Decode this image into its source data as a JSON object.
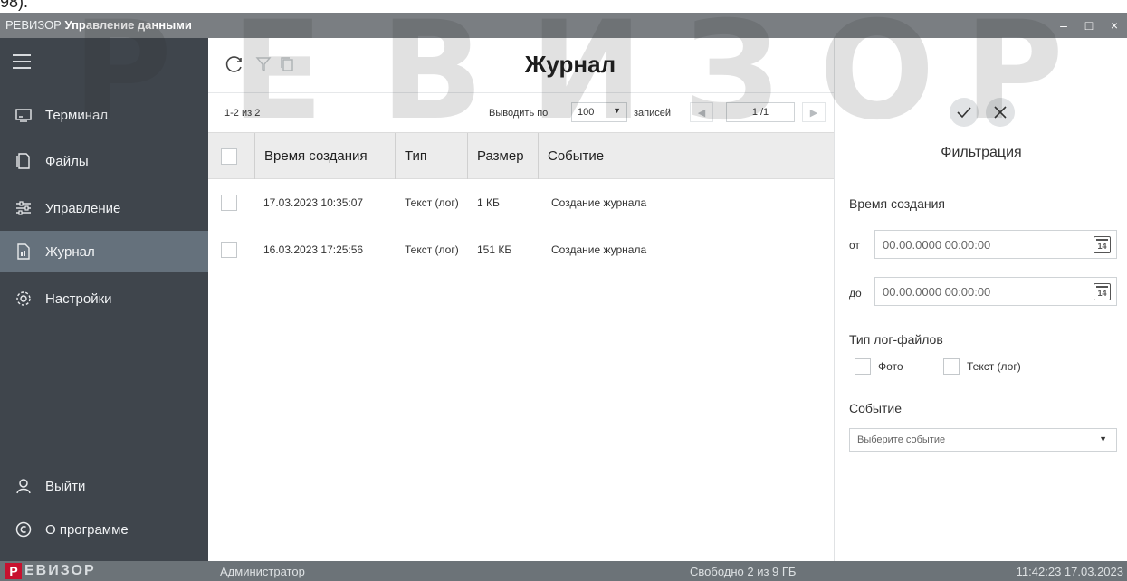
{
  "top_strip": "98).",
  "titlebar": {
    "brand": "РЕВИЗОР",
    "title": "Управление данными",
    "minimize": "–",
    "maximize": "□",
    "close": "×"
  },
  "sidebar": {
    "items": [
      {
        "label": "Терминал",
        "icon": "terminal-icon"
      },
      {
        "label": "Файлы",
        "icon": "files-icon"
      },
      {
        "label": "Управление",
        "icon": "sliders-icon"
      },
      {
        "label": "Журнал",
        "icon": "journal-icon",
        "active": true
      },
      {
        "label": "Настройки",
        "icon": "gear-icon"
      }
    ],
    "bottom": [
      {
        "label": "Выйти",
        "icon": "user-logout-icon"
      },
      {
        "label": "О программе",
        "icon": "copyright-icon"
      }
    ]
  },
  "main": {
    "title": "Журнал",
    "pager": {
      "count": "1-2 из 2",
      "per_page_label": "Выводить по",
      "per_page_value": "100",
      "records_label": "записей",
      "page": "1 /1"
    },
    "columns": [
      "Время создания",
      "Тип",
      "Размер",
      "Событие"
    ],
    "rows": [
      {
        "time": "17.03.2023 10:35:07",
        "type": "Текст (лог)",
        "size": "1 КБ",
        "event": "Создание журнала"
      },
      {
        "time": "16.03.2023 17:25:56",
        "type": "Текст (лог)",
        "size": "151 КБ",
        "event": "Создание журнала"
      }
    ]
  },
  "filter": {
    "title": "Фильтрация",
    "created_label": "Время создания",
    "from_label": "от",
    "from_value": "00.00.0000 00:00:00",
    "to_label": "до",
    "to_value": "00.00.0000 00:00:00",
    "calendar_day": "14",
    "type_label": "Тип лог-файлов",
    "type_photo": "Фото",
    "type_text": "Текст (лог)",
    "event_label": "Событие",
    "event_placeholder": "Выберите событие"
  },
  "statusbar": {
    "logo_letter": "Р",
    "logo_rest": "ЕВИЗОР",
    "user": "Администратор",
    "free": "Свободно 2 из 9 ГБ",
    "time": "11:42:23 17.03.2023"
  },
  "watermark": {
    "letters": [
      "Р",
      "Е",
      "В",
      "И",
      "З",
      "О",
      "Р"
    ]
  },
  "colors": {
    "sidebar": "#3f454c",
    "active_item": "#65717c",
    "titlebar": "#7a7e82",
    "statusbar": "#6c7378",
    "logo_red": "#c8102e"
  }
}
